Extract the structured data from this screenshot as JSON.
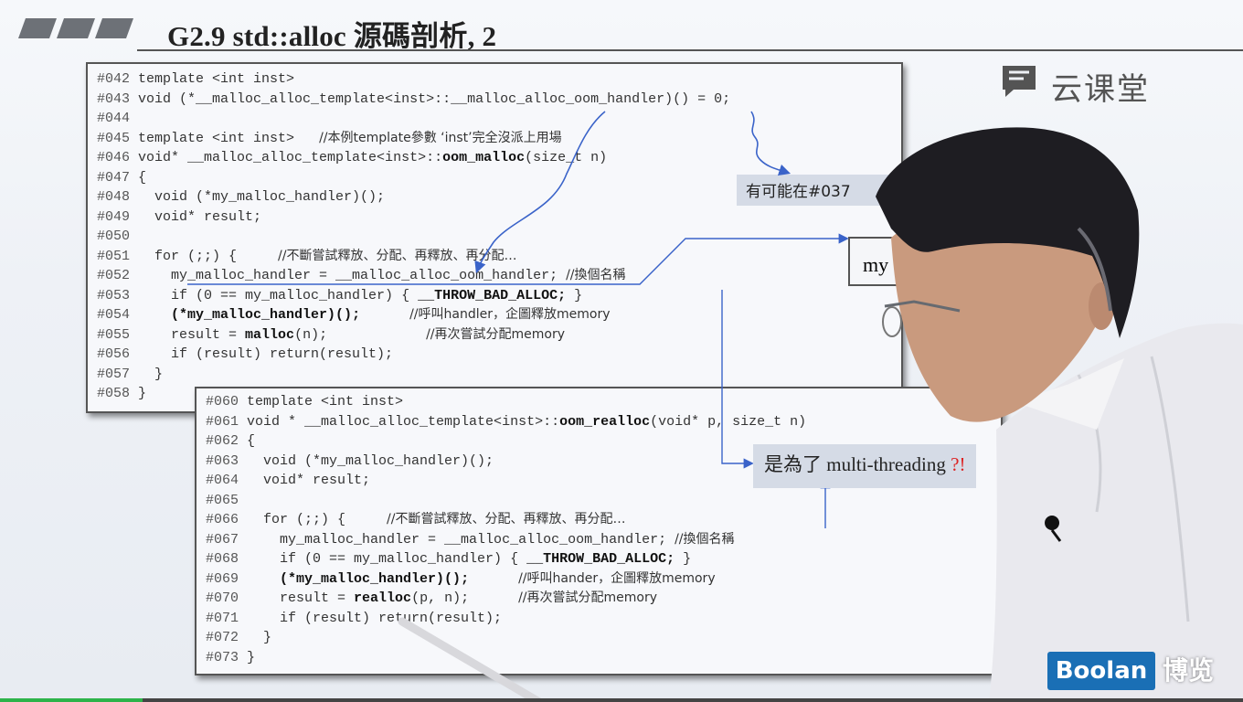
{
  "title": "G2.9 std::alloc 源碼剖析, 2",
  "code_block_1": [
    {
      "ln": "#042",
      "pre": " template <int inst>",
      "bold": "",
      "post": "",
      "comment": ""
    },
    {
      "ln": "#043",
      "pre": " void (*__malloc_alloc_template<inst>::__malloc_alloc_oom_handler)() = 0;",
      "bold": "",
      "post": "",
      "comment": ""
    },
    {
      "ln": "#044",
      "pre": "",
      "bold": "",
      "post": "",
      "comment": ""
    },
    {
      "ln": "#045",
      "pre": " template <int inst>   ",
      "bold": "",
      "post": "",
      "comment": "//本例template參數 ‘inst’完全沒派上用場"
    },
    {
      "ln": "#046",
      "pre": " void* __malloc_alloc_template<inst>::",
      "bold": "oom_malloc",
      "post": "(size_t n)",
      "comment": ""
    },
    {
      "ln": "#047",
      "pre": " {",
      "bold": "",
      "post": "",
      "comment": ""
    },
    {
      "ln": "#048",
      "pre": "   void (*my_malloc_handler)();",
      "bold": "",
      "post": "",
      "comment": ""
    },
    {
      "ln": "#049",
      "pre": "   void* result;",
      "bold": "",
      "post": "",
      "comment": ""
    },
    {
      "ln": "#050",
      "pre": "",
      "bold": "",
      "post": "",
      "comment": ""
    },
    {
      "ln": "#051",
      "pre": "   for (;;) {     ",
      "bold": "",
      "post": "",
      "comment": "//不斷嘗試釋放、分配、再釋放、再分配…"
    },
    {
      "ln": "#052",
      "pre": "     my_malloc_handler = __malloc_alloc_oom_handler; ",
      "bold": "",
      "post": "",
      "comment": "//換個名稱"
    },
    {
      "ln": "#053",
      "pre": "     if (0 == my_malloc_handler) { ",
      "bold": "__THROW_BAD_ALLOC;",
      "post": " }",
      "comment": ""
    },
    {
      "ln": "#054",
      "pre": "     ",
      "bold": "(*my_malloc_handler)();",
      "post": "      ",
      "comment": "//呼叫handler，企圖釋放memory"
    },
    {
      "ln": "#055",
      "pre": "     result = ",
      "bold": "malloc",
      "post": "(n);            ",
      "comment": "//再次嘗試分配memory"
    },
    {
      "ln": "#056",
      "pre": "     if (result) return(result);",
      "bold": "",
      "post": "",
      "comment": ""
    },
    {
      "ln": "#057",
      "pre": "   }",
      "bold": "",
      "post": "",
      "comment": ""
    },
    {
      "ln": "#058",
      "pre": " }",
      "bold": "",
      "post": "",
      "comment": ""
    }
  ],
  "code_block_2": [
    {
      "ln": "#060",
      "pre": " template <int inst>",
      "bold": "",
      "post": "",
      "comment": ""
    },
    {
      "ln": "#061",
      "pre": " void * __malloc_alloc_template<inst>::",
      "bold": "oom_realloc",
      "post": "(void* p, size_t n)",
      "comment": ""
    },
    {
      "ln": "#062",
      "pre": " {",
      "bold": "",
      "post": "",
      "comment": ""
    },
    {
      "ln": "#063",
      "pre": "   void (*my_malloc_handler)();",
      "bold": "",
      "post": "",
      "comment": ""
    },
    {
      "ln": "#064",
      "pre": "   void* result;",
      "bold": "",
      "post": "",
      "comment": ""
    },
    {
      "ln": "#065",
      "pre": "",
      "bold": "",
      "post": "",
      "comment": ""
    },
    {
      "ln": "#066",
      "pre": "   for (;;) {     ",
      "bold": "",
      "post": "",
      "comment": "//不斷嘗試釋放、分配、再釋放、再分配…"
    },
    {
      "ln": "#067",
      "pre": "     my_malloc_handler = __malloc_alloc_oom_handler; ",
      "bold": "",
      "post": "",
      "comment": "//換個名稱"
    },
    {
      "ln": "#068",
      "pre": "     if (0 == my_malloc_handler) { ",
      "bold": "__THROW_BAD_ALLOC;",
      "post": " }",
      "comment": ""
    },
    {
      "ln": "#069",
      "pre": "     ",
      "bold": "(*my_malloc_handler)();",
      "post": "      ",
      "comment": "//呼叫hander，企圖釋放memory"
    },
    {
      "ln": "#070",
      "pre": "     result = ",
      "bold": "realloc",
      "post": "(p, n);      ",
      "comment": "//再次嘗試分配memory"
    },
    {
      "ln": "#071",
      "pre": "     if (result) return(result);",
      "bold": "",
      "post": "",
      "comment": ""
    },
    {
      "ln": "#072",
      "pre": "   }",
      "bold": "",
      "post": "",
      "comment": ""
    },
    {
      "ln": "#073",
      "pre": " }",
      "bold": "",
      "post": "",
      "comment": ""
    }
  ],
  "callouts": {
    "note_037": "有可能在#037",
    "my_box": "my",
    "multithreading_main": "是為了 multi-threading ",
    "multithreading_mark": "?!"
  },
  "logos": {
    "yunketang": "云课堂",
    "boolan": "Boolan",
    "boolan_cn": "博览"
  },
  "video": {
    "progress_fraction": 0.115
  },
  "colors": {
    "boolan_blue": "#1a6fb5",
    "arrow_blue": "#3a63c9",
    "progress_green": "#2db34a",
    "question_red": "#dd2222"
  }
}
